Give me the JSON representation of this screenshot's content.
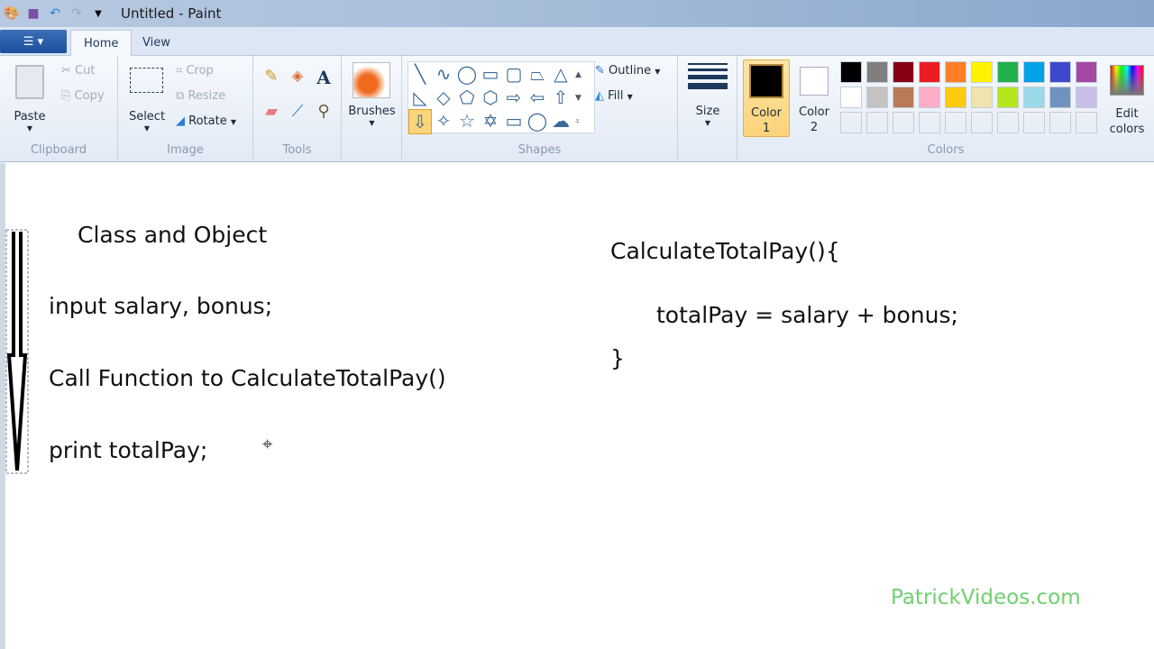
{
  "window": {
    "title": "Untitled - Paint"
  },
  "tabs": [
    {
      "label": "Home"
    },
    {
      "label": "View"
    }
  ],
  "clipboard": {
    "paste": "Paste",
    "cut": "Cut",
    "copy": "Copy",
    "group": "Clipboard"
  },
  "image": {
    "select": "Select",
    "crop": "Crop",
    "resize": "Resize",
    "rotate": "Rotate",
    "group": "Image"
  },
  "tools": {
    "group": "Tools"
  },
  "brushes": {
    "label": "Brushes"
  },
  "shapes": {
    "outline": "Outline",
    "fill": "Fill",
    "group": "Shapes"
  },
  "size": {
    "label": "Size"
  },
  "color1": {
    "label": "Color",
    "num": "1"
  },
  "color2": {
    "label": "Color",
    "num": "2"
  },
  "colors": {
    "group": "Colors",
    "edit1": "Edit",
    "edit2": "colors",
    "palette": [
      "#000000",
      "#7f7f7f",
      "#880015",
      "#ed1c24",
      "#ff7f27",
      "#fff200",
      "#22b14c",
      "#00a2e8",
      "#3f48cc",
      "#a349a4",
      "#ffffff",
      "#c3c3c3",
      "#b97a57",
      "#ffaec9",
      "#ffc90e",
      "#efe4b0",
      "#b5e61d",
      "#99d9ea",
      "#7092be",
      "#c8bfe7"
    ]
  },
  "canvas": {
    "title": "Class and Object",
    "line1": "input salary, bonus;",
    "line2": "Call Function to CalculateTotalPay()",
    "line3": "print totalPay;",
    "fn_head": "CalculateTotalPay(){",
    "fn_body": "totalPay = salary + bonus;",
    "fn_close": "}",
    "watermark": "PatrickVideos.com"
  }
}
